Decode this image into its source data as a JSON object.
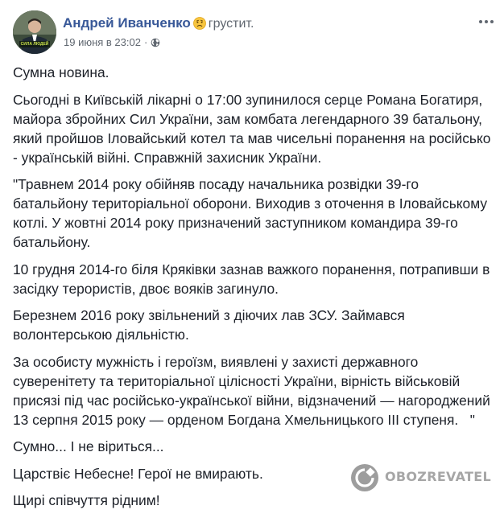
{
  "post": {
    "author": "Андрей Иванченко",
    "feeling": "грустит.",
    "feeling_icon": "sad-face-icon",
    "timestamp": "19 июня в 23:02",
    "meta_separator": "·",
    "privacy_icon": "globe-icon",
    "avatar_caption": "СИЛА ЛЮДЕЙ",
    "paragraphs": [
      "Сумна новина.",
      "Сьогодні в Київській лікарні о 17:00 зупинилося серце Романа Богатиря, майора збройних Сил України, зам комбата легендарного 39 батальону, який пройшов Іловайський котел та мав чисельні поранення на російсько - українській війні. Справжній захисник України.",
      "\"Травнем 2014 року обійняв посаду начальника розвідки 39-го батальйону територіальної оборони. Виходив з оточення в Іловайському котлі. У жовтні 2014 року призначений заступником командира 39-го батальйону.",
      "10 грудня 2014-го біля Кряківки зазнав важкого поранення, потрапивши в засідку терористів, двоє вояків загинуло.",
      "Березнем 2016 року звільнений з діючих лав ЗСУ. Займався волонтерською діяльністю.",
      "За особисту мужність і героїзм, виявлені у захисті державного суверенітету та територіальної цілісності України, вірність військовій присязі під час російсько-української війни, відзначений — нагороджений 13 серпня 2015 року — орденом Богдана Хмельницького III ступеня.   \"",
      "Сумно... І не віриться...",
      "Царствіє Небесне! Герої не вмирають.",
      "Щирі співчуття рідним!"
    ]
  },
  "watermark": {
    "text": "OBOZREVATEL"
  },
  "colors": {
    "author": "#385898",
    "text": "#1d2129",
    "meta": "#606770",
    "feeling_face": "#f7c53f"
  }
}
